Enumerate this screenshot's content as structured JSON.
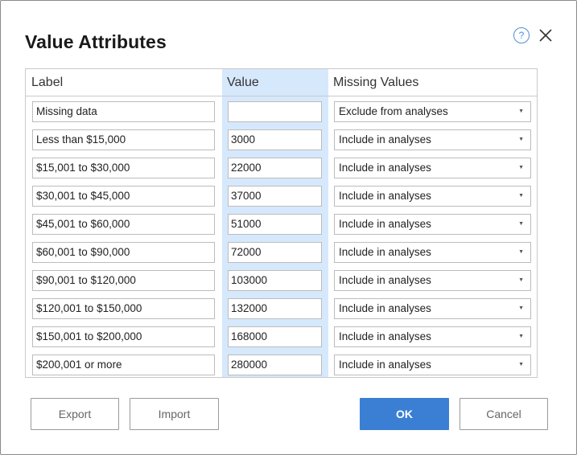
{
  "dialog": {
    "title": "Value Attributes",
    "help_symbol": "?"
  },
  "table": {
    "headers": {
      "label": "Label",
      "value": "Value",
      "missing": "Missing Values"
    },
    "rows": [
      {
        "label": "Missing data",
        "value": "",
        "missing": "Exclude from analyses"
      },
      {
        "label": "Less than $15,000",
        "value": "3000",
        "missing": "Include in analyses"
      },
      {
        "label": "$15,001 to $30,000",
        "value": "22000",
        "missing": "Include in analyses"
      },
      {
        "label": "$30,001 to $45,000",
        "value": "37000",
        "missing": "Include in analyses"
      },
      {
        "label": "$45,001 to $60,000",
        "value": "51000",
        "missing": "Include in analyses"
      },
      {
        "label": "$60,001 to $90,000",
        "value": "72000",
        "missing": "Include in analyses"
      },
      {
        "label": "$90,001 to $120,000",
        "value": "103000",
        "missing": "Include in analyses"
      },
      {
        "label": "$120,001 to $150,000",
        "value": "132000",
        "missing": "Include in analyses"
      },
      {
        "label": "$150,001 to $200,000",
        "value": "168000",
        "missing": "Include in analyses"
      },
      {
        "label": "$200,001 or more",
        "value": "280000",
        "missing": "Include in analyses"
      }
    ]
  },
  "buttons": {
    "export": "Export",
    "import": "Import",
    "ok": "OK",
    "cancel": "Cancel"
  },
  "colors": {
    "accent": "#3b7fd4",
    "value_column_highlight": "#d6e8fc",
    "help_icon": "#4f8fd6"
  },
  "icons": {
    "help": "help-circle-icon",
    "close": "close-icon",
    "dropdown": "chevron-down-icon"
  }
}
